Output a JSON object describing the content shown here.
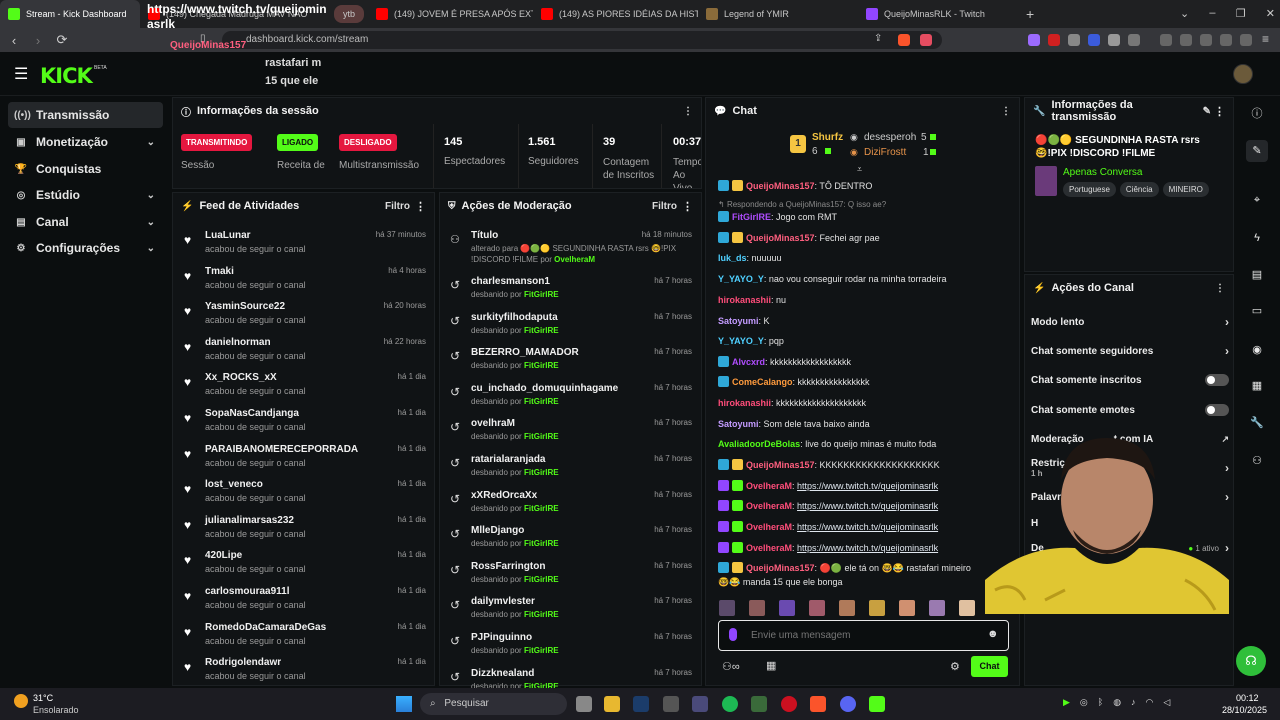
{
  "browser": {
    "tabs": [
      {
        "title": "Stream - Kick Dashboard",
        "active": true
      },
      {
        "title": "(149) Chegada Madruga MAV NAO"
      },
      {
        "title": "ytb"
      },
      {
        "title": "(149) JOVEM É PRESA APÓS EXTORQ"
      },
      {
        "title": "(149) AS PIORES IDÉIAS DA HISTÓRIA"
      },
      {
        "title": "Legend of YMIR"
      },
      {
        "title": "QueijoMinasRLK - Twitch"
      }
    ],
    "new_tab": "+",
    "url": "dashboard.kick.com/stream"
  },
  "overlay": {
    "link_text": "https://www.twitch.tv/queijomin asrlk",
    "user": "QueijoMinas157",
    "msg1": "rastafari m",
    "msg2": "15 que ele"
  },
  "kick": {
    "logo": "KICK",
    "beta": "BETA"
  },
  "sidebar": {
    "items": [
      {
        "label": "Transmissão",
        "icon": "broadcast-icon"
      },
      {
        "label": "Monetização",
        "icon": "money-icon"
      },
      {
        "label": "Conquistas",
        "icon": "trophy-icon"
      },
      {
        "label": "Estúdio",
        "icon": "studio-icon"
      },
      {
        "label": "Canal",
        "icon": "channel-icon"
      },
      {
        "label": "Configurações",
        "icon": "gear-icon"
      }
    ]
  },
  "session": {
    "title": "Informações da sessão",
    "stats": [
      {
        "value": "TRANSMITINDO",
        "label": "Sessão"
      },
      {
        "value": "LIGADO",
        "label": "Receita de"
      },
      {
        "value": "DESLIGADO",
        "label": "Multistransmissão"
      },
      {
        "value": "145",
        "label": "Espectadores"
      },
      {
        "value": "1.561",
        "label": "Seguidores"
      },
      {
        "value": "39",
        "label": "Contagem de Inscritos"
      },
      {
        "value": "00:37:",
        "label": "Tempo Ao Vivo"
      }
    ],
    "colors": {
      "red": "#e5173f",
      "green": "#53fc18"
    }
  },
  "feed": {
    "title": "Feed de Atividades",
    "filter": "Filtro",
    "items": [
      {
        "name": "LuaLunar",
        "desc": "acabou de seguir o canal",
        "time": "há 37 minutos"
      },
      {
        "name": "Tmaki",
        "desc": "acabou de seguir o canal",
        "time": "há 4 horas"
      },
      {
        "name": "YasminSource22",
        "desc": "acabou de seguir o canal",
        "time": "há 20 horas"
      },
      {
        "name": "danielnorman",
        "desc": "acabou de seguir o canal",
        "time": "há 22 horas"
      },
      {
        "name": "Xx_ROCKS_xX",
        "desc": "acabou de seguir o canal",
        "time": "há 1 dia"
      },
      {
        "name": "SopaNasCandjanga",
        "desc": "acabou de seguir o canal",
        "time": "há 1 dia"
      },
      {
        "name": "PARAIBANOMERECEPORRADA",
        "desc": "acabou de seguir o canal",
        "time": "há 1 dia"
      },
      {
        "name": "lost_veneco",
        "desc": "acabou de seguir o canal",
        "time": "há 1 dia"
      },
      {
        "name": "julianalimarsas232",
        "desc": "acabou de seguir o canal",
        "time": "há 1 dia"
      },
      {
        "name": "420Lipe",
        "desc": "acabou de seguir o canal",
        "time": "há 1 dia"
      },
      {
        "name": "carlosmouraa911l",
        "desc": "acabou de seguir o canal",
        "time": "há 1 dia"
      },
      {
        "name": "RomedoDaCamaraDeGas",
        "desc": "acabou de seguir o canal",
        "time": "há 1 dia"
      },
      {
        "name": "Rodrigolendawr",
        "desc": "acabou de seguir o canal",
        "time": "há 1 dia"
      }
    ]
  },
  "moderation": {
    "title": "Ações de Moderação",
    "filter": "Filtro",
    "first": {
      "name": "Título",
      "desc": "alterado para 🔴🟢🟡 SEGUNDINHA RASTA rsrs 🤓!PIX !DISCORD !FILME por",
      "by": "OvelheraM",
      "time": "há 18 minutos"
    },
    "action": "desbanido por",
    "mod": "FitGirlRE",
    "items": [
      {
        "name": "charlesmanson1",
        "time": "há 7 horas"
      },
      {
        "name": "surkityfilhodaputa",
        "time": "há 7 horas"
      },
      {
        "name": "BEZERRO_MAMADOR",
        "time": "há 7 horas"
      },
      {
        "name": "cu_inchado_domuquinhagame",
        "time": "há 7 horas"
      },
      {
        "name": "ovelhraM",
        "time": "há 7 horas"
      },
      {
        "name": "ratarialaranjada",
        "time": "há 7 horas"
      },
      {
        "name": "xXRedOrcaXx",
        "time": "há 7 horas"
      },
      {
        "name": "MlleDjango",
        "time": "há 7 horas"
      },
      {
        "name": "RossFarrington",
        "time": "há 7 horas"
      },
      {
        "name": "dailymvlester",
        "time": "há 7 horas"
      },
      {
        "name": "PJPinguinno",
        "time": "há 7 horas"
      },
      {
        "name": "Dizzknealand",
        "time": "há 7 horas"
      }
    ]
  },
  "chat": {
    "title": "Chat",
    "leaderboard": {
      "first": {
        "name": "Shurfz",
        "count": "6"
      },
      "second": {
        "name": "desesperoh",
        "count": "5"
      },
      "third": {
        "name": "DiziFrostt",
        "count": "1"
      }
    },
    "messages": [
      {
        "user": "QueijoMinas157",
        "color": "#ff5f7f",
        "text": "TÔ DENTRO"
      },
      {
        "reply": "Respondendo a QueijoMinas157: Q isso ae?"
      },
      {
        "user": "FitGirlRE",
        "color": "#b04dff",
        "text": "Jogo com RMT"
      },
      {
        "user": "QueijoMinas157",
        "color": "#ff5f7f",
        "text": "Fechei agr pae"
      },
      {
        "user": "luk_ds",
        "color": "#4fd0ff",
        "text": "nuuuuu"
      },
      {
        "user": "Y_YAYO_Y",
        "color": "#4fd0ff",
        "text": "nao vou conseguir rodar na minha torradeira"
      },
      {
        "user": "hirokanashii",
        "color": "#ff4d7a",
        "text": "nu"
      },
      {
        "user": "Satoyumi",
        "color": "#c39bff",
        "text": "K"
      },
      {
        "user": "Y_YAYO_Y",
        "color": "#4fd0ff",
        "text": "pqp"
      },
      {
        "user": "Alvcxrd",
        "color": "#b04dff",
        "text": "kkkkkkkkkkkkkkkkkk"
      },
      {
        "user": "ComeCalango",
        "color": "#ff9b3d",
        "text": "kkkkkkkkkkkkkkkk"
      },
      {
        "user": "hirokanashii",
        "color": "#ff4d7a",
        "text": "kkkkkkkkkkkkkkkkkkkk"
      },
      {
        "user": "Satoyumi",
        "color": "#c39bff",
        "text": "Som dele tava baixo ainda"
      },
      {
        "user": "AvaliadoorDeBolas",
        "color": "#53fc18",
        "text": "live do queijo minas é muito foda"
      },
      {
        "user": "QueijoMinas157",
        "color": "#ff5f7f",
        "text": "KKKKKKKKKKKKKKKKKKKK"
      },
      {
        "user": "OvelheraM",
        "color": "#ff4d7a",
        "text": "https://www.twitch.tv/queijominasrlk"
      },
      {
        "user": "OvelheraM",
        "color": "#ff4d7a",
        "text": "https://www.twitch.tv/queijominasrlk"
      },
      {
        "user": "OvelheraM",
        "color": "#ff4d7a",
        "text": "https://www.twitch.tv/queijominasrlk"
      },
      {
        "user": "OvelheraM",
        "color": "#ff4d7a",
        "text": "https://www.twitch.tv/queijominasrlk"
      },
      {
        "user": "QueijoMinas157",
        "color": "#ff5f7f",
        "text": "🔴🟢 ele tá on 🤓😂 rastafari mineiro"
      },
      {
        "cont": "🤓😂 manda 15 que ele bonga"
      }
    ],
    "placeholder": "Envie uma mensagem",
    "send": "Chat"
  },
  "stream_info": {
    "title": "Informações da transmissão",
    "stream_title": "🔴🟢🟡 SEGUNDINHA RASTA rsrs 🤓!PIX !DISCORD !FILME",
    "category": "Apenas Conversa",
    "tags": [
      "Portuguese",
      "Ciência",
      "MINEIRO"
    ]
  },
  "channel_actions": {
    "title": "Ações do Canal",
    "items": [
      {
        "label": "Modo lento",
        "type": "arrow"
      },
      {
        "label": "Chat somente seguidores",
        "type": "arrow"
      },
      {
        "label": "Chat somente inscritos",
        "type": "toggle"
      },
      {
        "label": "Chat somente emotes",
        "type": "toggle"
      },
      {
        "label": "Moderação",
        "type": "ext",
        "extra": "t com IA"
      },
      {
        "label": "Restriç",
        "sub": "1 h",
        "type": "arrow"
      },
      {
        "label": "Palavra",
        "type": "arrow"
      },
      {
        "label": "H",
        "type": "none"
      },
      {
        "label": "De",
        "type": "active",
        "extra": "1 ativo"
      }
    ]
  },
  "taskbar": {
    "temp": "31°C",
    "weather": "Ensolarado",
    "search": "Pesquisar",
    "time": "00:12",
    "date": "28/10/2025"
  }
}
